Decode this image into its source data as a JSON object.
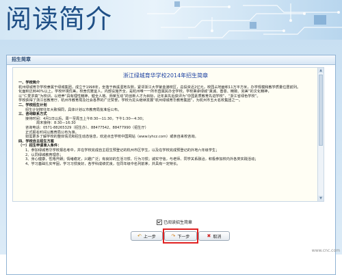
{
  "banner": {
    "title": "阅读简介"
  },
  "panel": {
    "header": "招生简章",
    "agree_label": "已阅读招生简章"
  },
  "document": {
    "title": "浙江绿城育华学校2014年招生简章",
    "paragraphs": [
      {
        "style": "h",
        "text": "一、学校简介"
      },
      {
        "style": "p",
        "text": "杭州绿城育华学校隶属于绿城集团，成立于1998年，坐落于西溪湿地东侧，紧邻浙江大学紫金港校区，总投资近2亿元，校园占地面积11万平方米，办学规模和教学质量位居前列。"
      },
      {
        "style": "p",
        "text": "化面积达到40%以上。学校环境优美，校舍优雅宜人，内部设施齐全，是杭州唯一一所市直属民办全学校。学校秉承绿城“真诚、善意、精致、完美”的文化精神，"
      },
      {
        "style": "p",
        "text": "以“仁爱求真”为校训，以培养“具有理性精神、健全人格、师荣互动”的创新人才为目标，近年来先后获评为“中国素质教育先进学校”、“浙江省绿色学校”。"
      },
      {
        "style": "p",
        "text": "学校获得了浙江省教育厅、杭州市教育局及社会各界的广泛赞誉，学校为龙头继续发展“杭州绿城育华教育集团”，为杭州市五大名校集团之一。"
      },
      {
        "style": "h",
        "text": "二、学校招生计划"
      },
      {
        "style": "i",
        "text": "招生计划按往年大致相同，具体计划以市教育局批准后公布。"
      },
      {
        "style": "h",
        "text": "三、咨询联系方式"
      },
      {
        "style": "i",
        "text": "接待时间：4月1日以后，周一至周五上午8:30—11:30，下午1:30—4:30；"
      },
      {
        "style": "i2",
        "text": "周末接待：8:30—16:30"
      },
      {
        "style": "i",
        "text": "咨询电话：0571-88265329（招生办）、88477542、88477990（招生厅）"
      },
      {
        "style": "i",
        "text": "正式报名时间以教育局公布为准。"
      },
      {
        "style": "i",
        "text": "如需更多了解学校的整体情况和招生动态信息，欢迎点击学校中国网站（www.lyhcz.com）或亲自来校咨询。"
      },
      {
        "style": "h",
        "text": "四、学校自主招生方案"
      },
      {
        "style": "h",
        "text": "（一）招生申请准入条件："
      },
      {
        "style": "i",
        "text": "1、参加绿城育华学校报名考中，并在学校完成自主招生预登记的杭州市区学生，以及在学校完成预登记的外地六年级学生；"
      },
      {
        "style": "i",
        "text": "2、认同绿城教育理念；"
      },
      {
        "style": "i",
        "text": "3、身心健康，性格开朗；情绪稳定，兴趣广泛；有良好的生活习惯、行为习惯；诚实守信，与老师、同学关系融洽，积极参加校内外各类实践活动；"
      },
      {
        "style": "i",
        "text": "4、学习基础扎实牢固，学习习惯良好，各学科成绩优良，在同年级中名列前茅，并具有一定特长。"
      }
    ]
  },
  "buttons": {
    "prev": "上一步",
    "next": "下一步",
    "cancel": "取消"
  },
  "icons": {
    "prev": "back-arrow-icon",
    "next": "forward-arrow-icon",
    "cancel": "cancel-x-icon"
  },
  "scrollbar": {
    "position": 0.0
  },
  "watermark": "www.cnc.com",
  "colors": {
    "banner_title": "#1f4f86",
    "doc_title": "#1a3fa0",
    "highlight": "#e02020"
  }
}
